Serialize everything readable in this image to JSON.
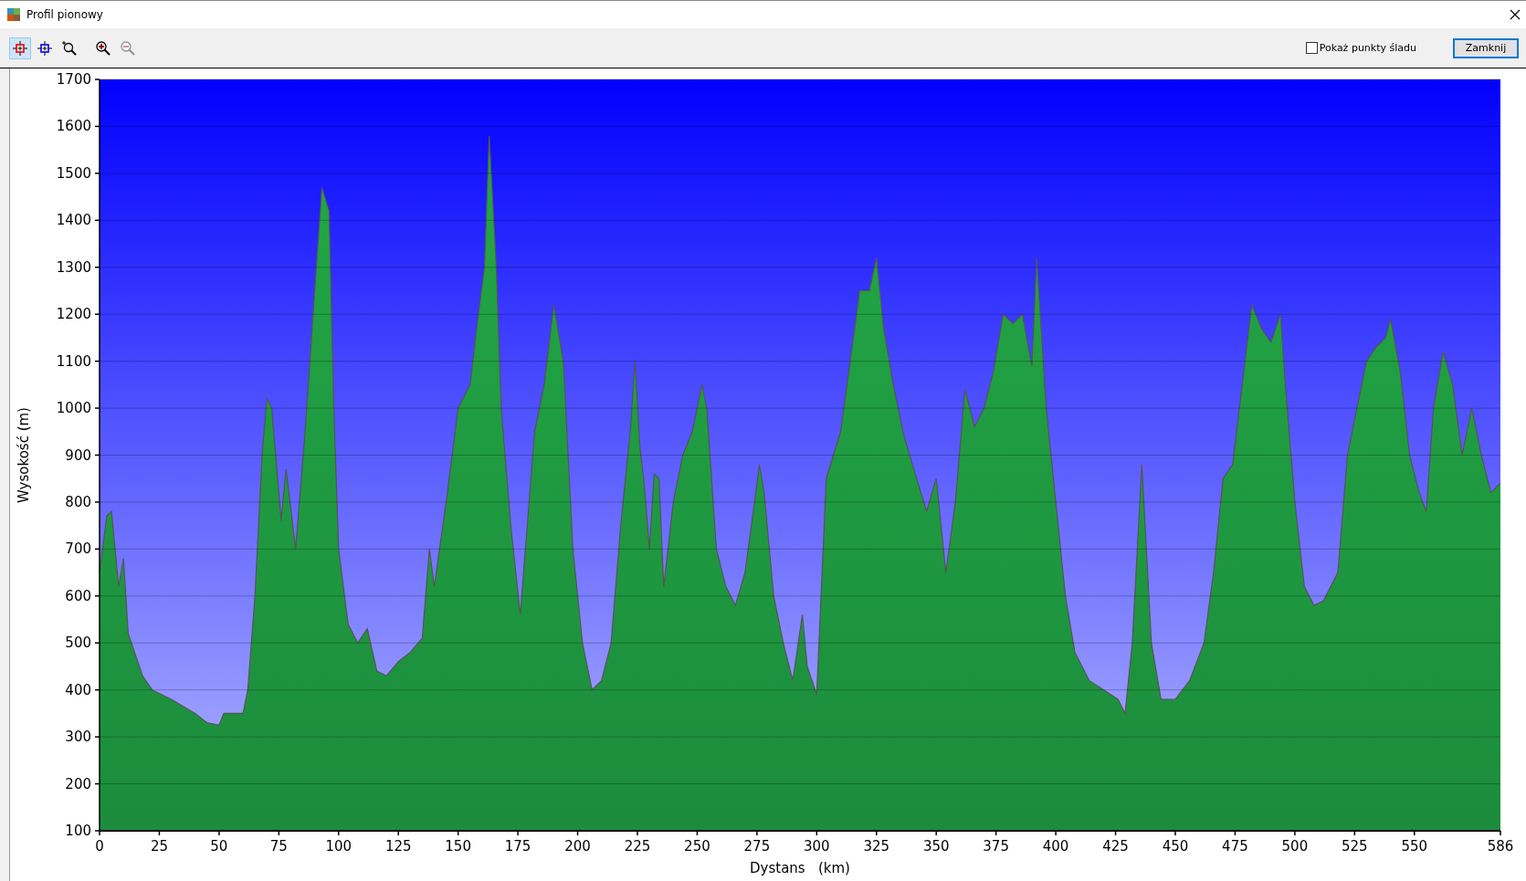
{
  "window": {
    "title": "Profil pionowy"
  },
  "toolbar": [
    {
      "kind": "marker-red",
      "selected": true,
      "disabled": false
    },
    {
      "kind": "marker-blue",
      "selected": false,
      "disabled": false
    },
    {
      "kind": "zoom-box",
      "selected": false,
      "disabled": false
    },
    {
      "kind": "zoom-in",
      "selected": false,
      "disabled": false
    },
    {
      "kind": "zoom-out",
      "selected": false,
      "disabled": true
    }
  ],
  "show_points": {
    "label": "Pokaż punkty śladu",
    "checked": false
  },
  "close_button": "Zamknij",
  "chart_data": {
    "type": "area",
    "xlabel": "Dystans   (km)",
    "ylabel": "Wysokość (m)",
    "x": [
      0,
      3,
      5,
      8,
      10,
      12,
      18,
      22,
      30,
      40,
      45,
      50,
      52,
      60,
      62,
      65,
      68,
      70,
      72,
      76,
      78,
      82,
      86,
      90,
      93,
      96,
      98,
      100,
      102,
      104,
      108,
      112,
      116,
      120,
      125,
      130,
      135,
      138,
      140,
      145,
      150,
      155,
      158,
      161,
      163,
      166,
      168,
      172,
      176,
      180,
      182,
      186,
      190,
      194,
      198,
      202,
      206,
      210,
      214,
      218,
      222,
      224,
      226,
      228,
      230,
      232,
      234,
      236,
      240,
      244,
      248,
      252,
      254,
      258,
      262,
      266,
      270,
      274,
      276,
      278,
      282,
      286,
      290,
      294,
      296,
      300,
      304,
      310,
      314,
      318,
      322,
      325,
      328,
      332,
      336,
      340,
      346,
      350,
      354,
      358,
      362,
      366,
      370,
      374,
      378,
      382,
      386,
      390,
      392,
      396,
      400,
      404,
      408,
      414,
      420,
      426,
      429,
      432,
      436,
      440,
      444,
      450,
      456,
      462,
      466,
      470,
      474,
      478,
      482,
      486,
      490,
      494,
      496,
      500,
      504,
      508,
      512,
      518,
      522,
      526,
      530,
      534,
      538,
      540,
      544,
      548,
      552,
      555,
      558,
      562,
      566,
      570,
      574,
      578,
      582,
      586
    ],
    "series": [
      {
        "color": "#22a846",
        "values": [
          650,
          770,
          780,
          620,
          680,
          520,
          430,
          400,
          380,
          350,
          330,
          325,
          350,
          350,
          400,
          600,
          900,
          1020,
          1000,
          760,
          870,
          700,
          950,
          1250,
          1470,
          1420,
          1000,
          700,
          620,
          540,
          500,
          530,
          440,
          430,
          460,
          480,
          510,
          700,
          620,
          800,
          1000,
          1050,
          1180,
          1300,
          1580,
          1300,
          1000,
          750,
          560,
          820,
          950,
          1050,
          1220,
          1100,
          700,
          500,
          400,
          420,
          500,
          750,
          950,
          1100,
          920,
          830,
          700,
          860,
          850,
          620,
          800,
          900,
          950,
          1050,
          1000,
          700,
          620,
          580,
          650,
          800,
          880,
          820,
          600,
          500,
          420,
          560,
          450,
          390,
          850,
          950,
          1100,
          1250,
          1250,
          1320,
          1170,
          1050,
          950,
          880,
          780,
          850,
          650,
          800,
          1040,
          960,
          1000,
          1080,
          1200,
          1180,
          1200,
          1090,
          1320,
          1000,
          800,
          600,
          480,
          420,
          400,
          380,
          350,
          500,
          880,
          500,
          380,
          380,
          420,
          500,
          650,
          850,
          880,
          1050,
          1220,
          1170,
          1140,
          1200,
          1050,
          800,
          620,
          580,
          590,
          650,
          900,
          1000,
          1100,
          1130,
          1150,
          1190,
          1080,
          900,
          820,
          780,
          1000,
          1120,
          1050,
          900,
          1000,
          900,
          820,
          840
        ]
      }
    ],
    "grid": true,
    "xlim": [
      0,
      586
    ],
    "ylim": [
      100,
      1700
    ],
    "xticks": [
      0,
      25,
      50,
      75,
      100,
      125,
      150,
      175,
      200,
      225,
      250,
      275,
      300,
      325,
      350,
      375,
      400,
      425,
      450,
      475,
      500,
      525,
      550,
      586
    ],
    "yticks": [
      100,
      200,
      300,
      400,
      500,
      600,
      700,
      800,
      900,
      1000,
      1100,
      1200,
      1300,
      1400,
      1500,
      1600,
      1700
    ]
  }
}
